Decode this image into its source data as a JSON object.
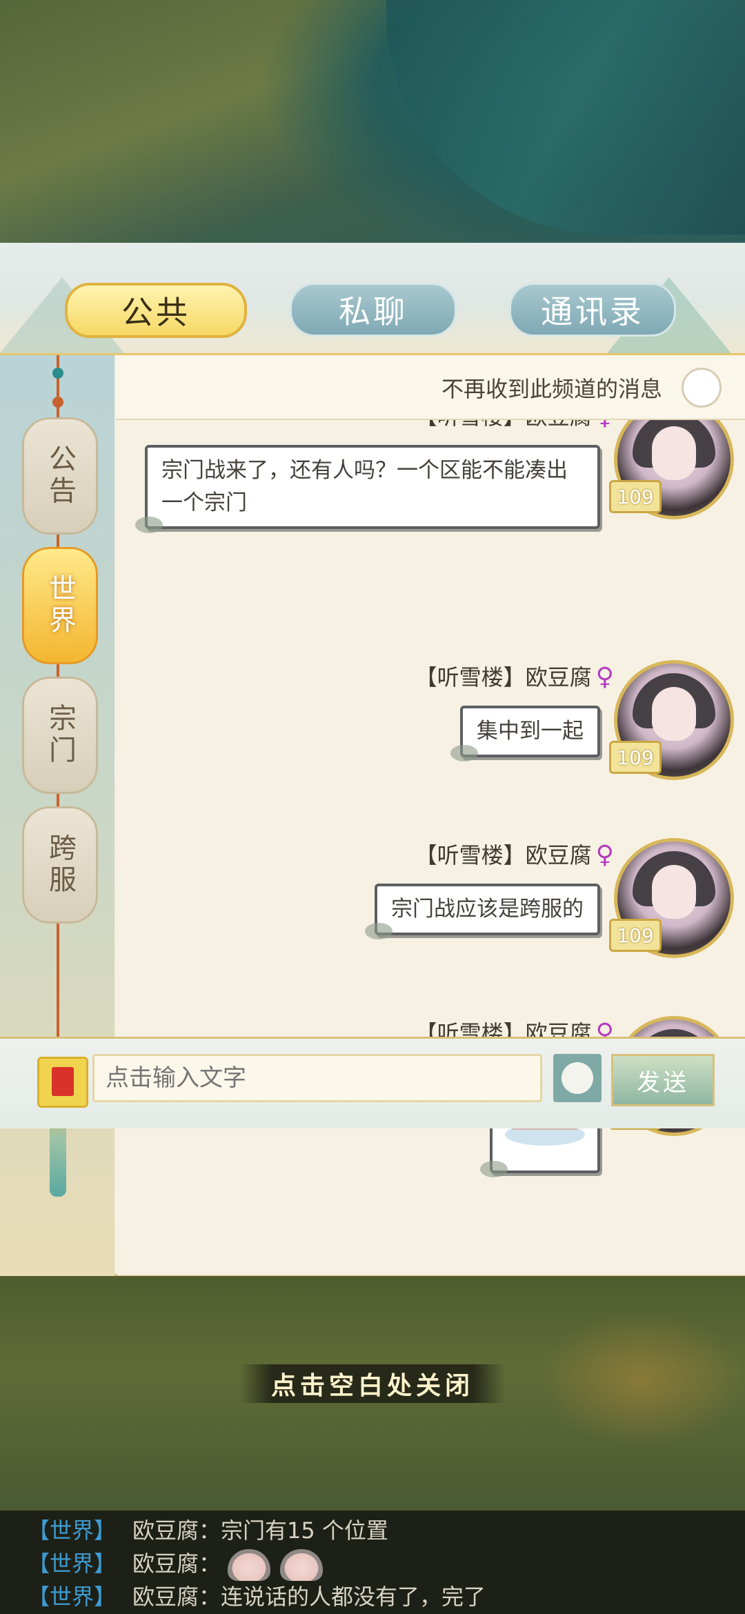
{
  "tabs": {
    "public": "公共",
    "private": "私聊",
    "contacts": "通讯录"
  },
  "sidebar": {
    "items": [
      {
        "label": "公告",
        "active": false
      },
      {
        "label": "世界",
        "active": true
      },
      {
        "label": "宗门",
        "active": false
      },
      {
        "label": "跨服",
        "active": false
      }
    ]
  },
  "mute": {
    "label": "不再收到此频道的消息"
  },
  "messages": [
    {
      "sender": "【听雪楼】欧豆腐",
      "gender_icon": "female-icon",
      "level": "109",
      "text": "宗门战来了，还有人吗？一个区能不能凑出一个宗门"
    },
    {
      "sender": "【听雪楼】欧豆腐",
      "gender_icon": "female-icon",
      "level": "109",
      "text": "集中到一起"
    },
    {
      "sender": "【听雪楼】欧豆腐",
      "gender_icon": "female-icon",
      "level": "109",
      "text": "宗门战应该是跨服的"
    },
    {
      "sender": "【听雪楼】欧豆腐",
      "gender_icon": "female-icon",
      "level": "109",
      "sticker": "crying-tofu-sticker"
    }
  ],
  "input": {
    "placeholder": "点击输入文字",
    "send_label": "发送"
  },
  "close_hint": "点击空白处关闭",
  "ticker": [
    {
      "channel": "【世界】",
      "text": "欧豆腐：宗门有15 个位置"
    },
    {
      "channel": "【世界】",
      "text": "欧豆腐：",
      "emojis": 2
    },
    {
      "channel": "【世界】",
      "text": "欧豆腐：连说话的人都没有了，完了"
    }
  ],
  "colors": {
    "active_tab": "#f5d865",
    "inactive_tab": "#7fa9b4",
    "channel_text": "#3d9ad0",
    "female_icon": "#b33cc0"
  }
}
